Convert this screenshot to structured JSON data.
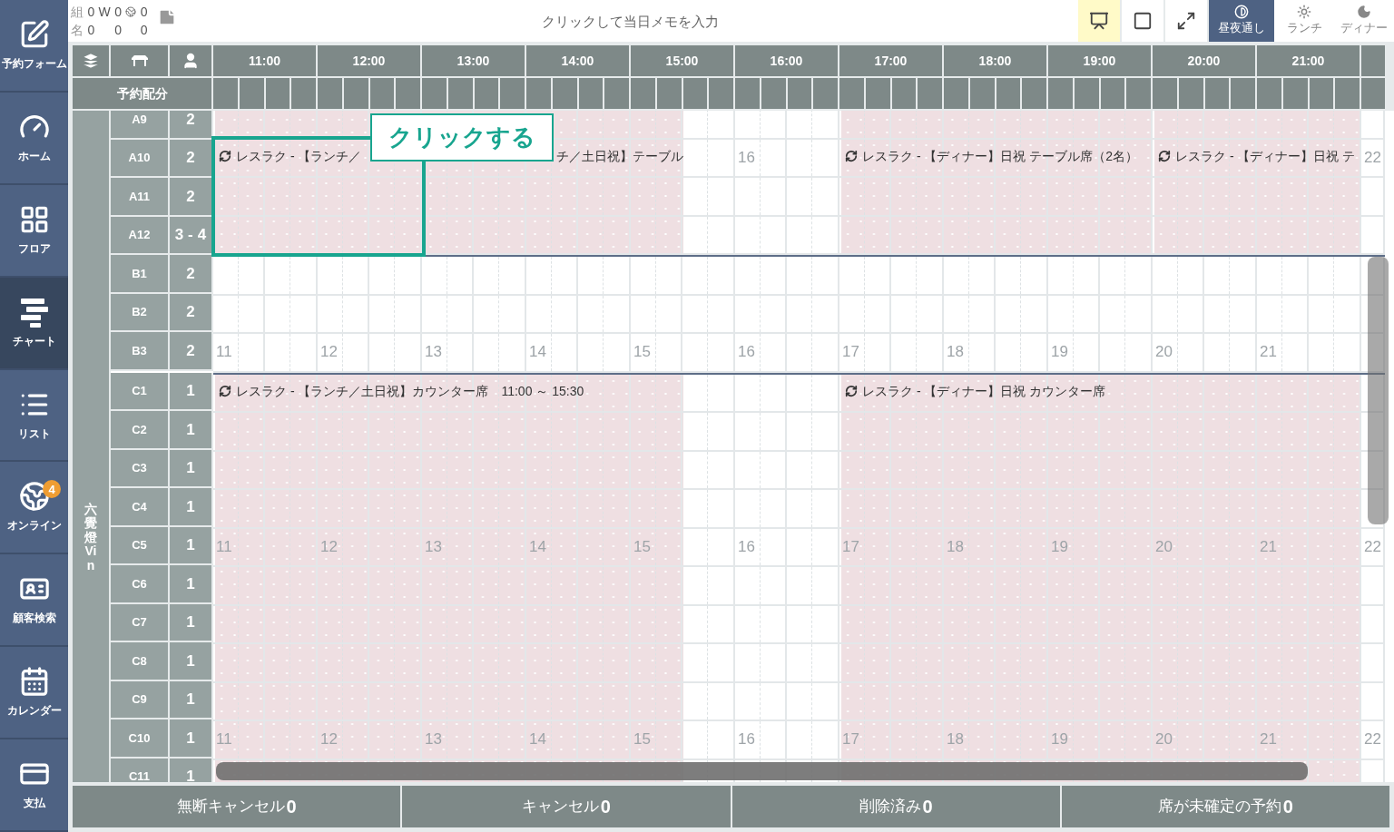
{
  "sidebar": {
    "items": [
      {
        "label": "予約フォーム",
        "selected": false
      },
      {
        "label": "ホーム",
        "selected": false
      },
      {
        "label": "フロア",
        "selected": false
      },
      {
        "label": "チャート",
        "selected": true
      },
      {
        "label": "リスト",
        "selected": false
      },
      {
        "label": "オンライン",
        "selected": false,
        "badge": "4"
      },
      {
        "label": "顧客検索",
        "selected": false
      },
      {
        "label": "カレンダー",
        "selected": false
      },
      {
        "label": "支払",
        "selected": false
      }
    ]
  },
  "top_bar": {
    "counts": {
      "group_label": "組",
      "group_values": [
        "0",
        "0",
        "0"
      ],
      "guest_label": "名",
      "guest_values": [
        "0",
        "0",
        "0"
      ],
      "walkin_mark": "W"
    },
    "memo": {
      "placeholder": "クリックして当日メモを入力"
    },
    "tools": [
      {
        "on": true
      },
      {
        "on": false
      },
      {
        "on": false
      }
    ],
    "modes": [
      {
        "label": "昼夜通し",
        "selected": true
      },
      {
        "label": "ランチ",
        "selected": false
      },
      {
        "label": "ディナー",
        "selected": false
      }
    ]
  },
  "chart": {
    "header": {
      "allocation_label": "予約配分",
      "hours": [
        "11:00",
        "12:00",
        "13:00",
        "14:00",
        "15:00",
        "16:00",
        "17:00",
        "18:00",
        "19:00",
        "20:00",
        "21:00"
      ]
    },
    "area_label": "六覺燈Vin",
    "groups": [
      {
        "services": [
          {
            "kind": "lunch"
          },
          {
            "kind": "dinner_early"
          },
          {
            "kind": "dinner_late"
          }
        ],
        "rows": [
          {
            "name": "A9",
            "capacity": "2"
          },
          {
            "name": "A10",
            "capacity": "2",
            "hour_labels": [
              {
                "text": "16",
                "kind": "break"
              },
              {
                "text": "22",
                "kind": "close"
              }
            ],
            "events": [
              {
                "kind": "lunch",
                "label": "レスラク - 【ランチ／",
                "label_tail": "チ／土日祝】テーブル"
              },
              {
                "kind": "dinner_early",
                "label": "レスラク - 【ディナー】日祝 テーブル席（2名）"
              },
              {
                "kind": "dinner_late",
                "label": "レスラク - 【ディナー】日祝 テ"
              }
            ]
          },
          {
            "name": "A11",
            "capacity": "2"
          },
          {
            "name": "A12",
            "capacity": "3 - **4**"
          }
        ]
      },
      {
        "rows": [
          {
            "name": "B1",
            "capacity": "2"
          },
          {
            "name": "B2",
            "capacity": "2"
          },
          {
            "name": "B3",
            "capacity": "2",
            "hour_labels": [
              "11",
              "12",
              "13",
              "14",
              "15",
              "16",
              "17",
              "18",
              "19",
              "20",
              "21"
            ]
          }
        ]
      },
      {
        "services": [
          {
            "kind": "lunch"
          },
          {
            "kind": "dinner"
          }
        ],
        "rows": [
          {
            "name": "C1",
            "capacity": "1",
            "events": [
              {
                "kind": "lunch",
                "label": "レスラク - 【ランチ／土日祝】カウンター席　11:00 ～ 15:30"
              },
              {
                "kind": "dinner",
                "label": "レスラク - 【ディナー】日祝 カウンター席"
              }
            ]
          },
          {
            "name": "C2",
            "capacity": "1"
          },
          {
            "name": "C3",
            "capacity": "1"
          },
          {
            "name": "C4",
            "capacity": "1"
          },
          {
            "name": "C5",
            "capacity": "1",
            "hour_labels": [
              "11",
              "12",
              "13",
              "14",
              "15",
              "16",
              "17",
              "18",
              "19",
              "20",
              "21",
              "22"
            ]
          },
          {
            "name": "C6",
            "capacity": "1"
          },
          {
            "name": "C7",
            "capacity": "1"
          },
          {
            "name": "C8",
            "capacity": "1"
          },
          {
            "name": "C9",
            "capacity": "1"
          },
          {
            "name": "C10",
            "capacity": "1",
            "hour_labels": [
              "11",
              "12",
              "13",
              "14",
              "15",
              "16",
              "17",
              "18",
              "19",
              "20",
              "21",
              "22"
            ]
          },
          {
            "name": "C11",
            "capacity": "1"
          }
        ]
      }
    ],
    "callout": {
      "label": "クリックする"
    }
  },
  "footer": [
    {
      "label": "無断キャンセル",
      "count": "0"
    },
    {
      "label": "キャンセル",
      "count": "0"
    },
    {
      "label": "削除済み",
      "count": "0"
    },
    {
      "label": "席が未確定の予約",
      "count": "0"
    }
  ]
}
